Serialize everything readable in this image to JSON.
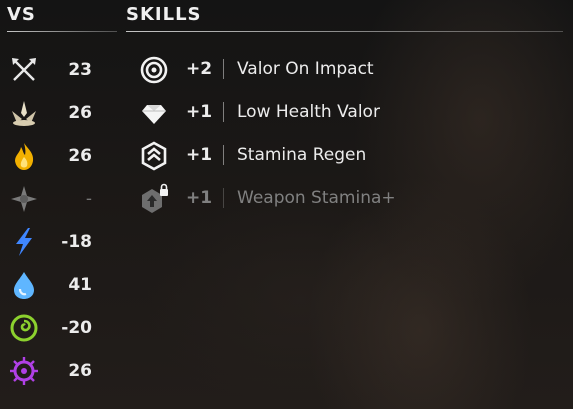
{
  "vs_header": "VS",
  "skills_header": "SKILLS",
  "vs": [
    {
      "icon": "melee-icon",
      "value": "23"
    },
    {
      "icon": "ranged-icon",
      "value": "26"
    },
    {
      "icon": "fire-icon",
      "value": "26"
    },
    {
      "icon": "tear-icon",
      "value": "-"
    },
    {
      "icon": "shock-icon",
      "value": "-18"
    },
    {
      "icon": "frost-icon",
      "value": "41"
    },
    {
      "icon": "acid-icon",
      "value": "-20"
    },
    {
      "icon": "purgewater-icon",
      "value": "26"
    }
  ],
  "skills": [
    {
      "icon": "valor-target-icon",
      "level": "+2",
      "name": "Valor On Impact",
      "locked": false
    },
    {
      "icon": "gem-icon",
      "level": "+1",
      "name": "Low Health Valor",
      "locked": false
    },
    {
      "icon": "stamina-regen-icon",
      "level": "+1",
      "name": "Stamina Regen",
      "locked": false
    },
    {
      "icon": "weapon-stamina-locked-icon",
      "level": "+1",
      "name": "Weapon Stamina+",
      "locked": true
    }
  ],
  "colors": {
    "fire": "#f2b000",
    "shock": "#3f86ff",
    "frost": "#5fb6ff",
    "acid": "#8cd12e",
    "purgewater": "#b040e6",
    "tear": "#8a8a8a"
  }
}
